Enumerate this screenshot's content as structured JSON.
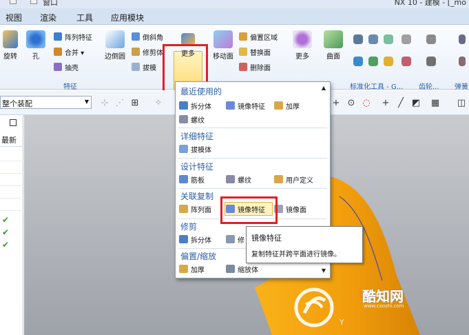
{
  "window": {
    "title_fragment": "NX 10 - 建模 - [_mo",
    "window_menu": "窗口"
  },
  "menubar": [
    "视图",
    "渲染",
    "工具",
    "应用模块"
  ],
  "ribbon": {
    "big_buttons": [
      {
        "label": "旋转",
        "icon": "revolve-icon"
      },
      {
        "label": "孔",
        "icon": "hole-icon"
      },
      {
        "label": "边倒圆",
        "icon": "edge-blend-icon"
      },
      {
        "label": "更多",
        "icon": "more-icon"
      },
      {
        "label": "移动面",
        "icon": "move-face-icon"
      },
      {
        "label": "更多",
        "icon": "more-icon"
      },
      {
        "label": "曲面",
        "icon": "surface-icon"
      }
    ],
    "small_buttons": [
      {
        "label": "阵列特征",
        "icon": "pattern-feature-icon"
      },
      {
        "label": "合并 ▾",
        "icon": "unite-icon"
      },
      {
        "label": "抽壳",
        "icon": "shell-icon"
      },
      {
        "label": "倒斜角",
        "icon": "chamfer-icon"
      },
      {
        "label": "修剪体",
        "icon": "trim-body-icon"
      },
      {
        "label": "拔模",
        "icon": "draft-icon"
      },
      {
        "label": "偏置区域",
        "icon": "offset-region-icon"
      },
      {
        "label": "替换面",
        "icon": "replace-face-icon"
      },
      {
        "label": "删除面",
        "icon": "delete-face-icon"
      }
    ],
    "group_labels": [
      "特征",
      "标准化工具 - G...",
      "齿轮...",
      "弹簧"
    ]
  },
  "toolbar2": {
    "assembly_filter": "整个装配"
  },
  "navigator": {
    "column_header": "最新",
    "rows_checked": 3
  },
  "dropdown": {
    "sections": [
      {
        "title": "最近使用的",
        "items": [
          {
            "label": "拆分体",
            "icon": "split-body-icon"
          },
          {
            "label": "镜像特征",
            "icon": "mirror-feature-icon"
          },
          {
            "label": "加厚",
            "icon": "thicken-icon"
          },
          {
            "label": "螺纹",
            "icon": "thread-icon"
          }
        ]
      },
      {
        "title": "详细特征",
        "items": [
          {
            "label": "拔模体",
            "icon": "draft-body-icon"
          }
        ]
      },
      {
        "title": "设计特征",
        "items": [
          {
            "label": "筋板",
            "icon": "rib-icon"
          },
          {
            "label": "螺纹",
            "icon": "thread-icon"
          },
          {
            "label": "用户定义",
            "icon": "user-defined-icon"
          }
        ]
      },
      {
        "title": "关联复制",
        "items": [
          {
            "label": "阵列面",
            "icon": "pattern-face-icon"
          },
          {
            "label": "镜像特征",
            "icon": "mirror-feature-icon"
          },
          {
            "label": "镜像面",
            "icon": "mirror-face-icon"
          }
        ]
      },
      {
        "title": "修剪",
        "items": [
          {
            "label": "拆分体",
            "icon": "split-body-icon"
          },
          {
            "label": "修",
            "icon": "trim-icon"
          }
        ]
      },
      {
        "title": "偏置/缩放",
        "items": [
          {
            "label": "加厚",
            "icon": "thicken-icon"
          },
          {
            "label": "缩放体",
            "icon": "scale-body-icon"
          }
        ]
      }
    ]
  },
  "tooltip": {
    "title": "镜像特征",
    "description": "复制特征并跨平面进行镜像。"
  },
  "watermark": {
    "site_name": "酷知网",
    "site_url": "www.coozhi.com"
  },
  "axis_label": "Y",
  "colors": {
    "highlight_red": "#e02020",
    "section_blue": "#2c5fa8",
    "check_green": "#2da02d",
    "model_orange": "#f2a20e"
  }
}
